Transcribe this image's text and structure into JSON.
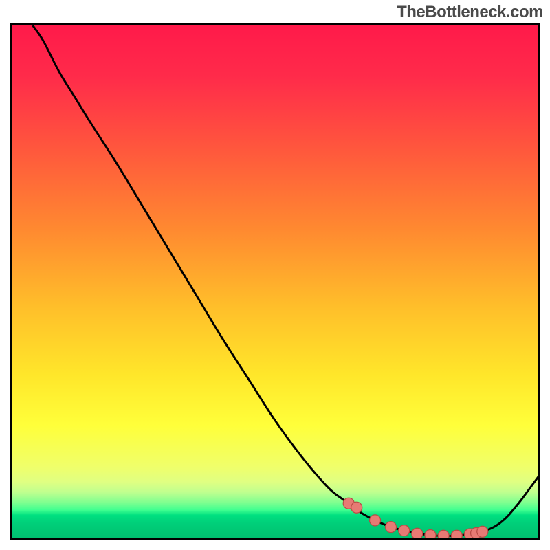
{
  "attribution": "TheBottleneck.com",
  "colors": {
    "gradient_stops": [
      {
        "offset": 0.0,
        "color": "#ff1a4a"
      },
      {
        "offset": 0.1,
        "color": "#ff2b4a"
      },
      {
        "offset": 0.25,
        "color": "#ff5a3c"
      },
      {
        "offset": 0.4,
        "color": "#ff8a30"
      },
      {
        "offset": 0.55,
        "color": "#ffbf2a"
      },
      {
        "offset": 0.68,
        "color": "#ffe62a"
      },
      {
        "offset": 0.78,
        "color": "#ffff3a"
      },
      {
        "offset": 0.82,
        "color": "#f7ff52"
      },
      {
        "offset": 0.86,
        "color": "#f0ff6a"
      },
      {
        "offset": 0.89,
        "color": "#e0ff82"
      },
      {
        "offset": 0.91,
        "color": "#c0ff8f"
      },
      {
        "offset": 0.93,
        "color": "#80ff90"
      },
      {
        "offset": 0.945,
        "color": "#40ff90"
      },
      {
        "offset": 0.955,
        "color": "#00e080"
      },
      {
        "offset": 0.97,
        "color": "#00d07a"
      },
      {
        "offset": 0.985,
        "color": "#00c874"
      },
      {
        "offset": 1.0,
        "color": "#00c070"
      }
    ],
    "curve": "#000000",
    "marker_fill": "#e77a74",
    "marker_stroke": "#b84a44"
  },
  "chart_data": {
    "type": "line",
    "title": "",
    "xlabel": "",
    "ylabel": "",
    "xlim": [
      0,
      100
    ],
    "ylim": [
      0,
      100
    ],
    "grid": false,
    "series": [
      {
        "name": "bottleneck-curve",
        "x": [
          4,
          6,
          9,
          12,
          15,
          20,
          25,
          30,
          35,
          40,
          45,
          50,
          55,
          60,
          63,
          66,
          69,
          72,
          75,
          78,
          81,
          84,
          87,
          90,
          93,
          96,
          100
        ],
        "y": [
          100,
          97,
          91,
          86,
          81,
          73,
          64.5,
          56,
          47.5,
          39,
          31,
          23,
          16,
          10,
          7.5,
          5.2,
          3.5,
          2.2,
          1.4,
          0.8,
          0.5,
          0.5,
          0.8,
          1.5,
          3.2,
          6.5,
          12
        ]
      }
    ],
    "markers": {
      "name": "highlight-points",
      "x": [
        64,
        65.5,
        69,
        72,
        74.5,
        77,
        79.5,
        82,
        84.5,
        87,
        88.2,
        89.4
      ],
      "y": [
        6.8,
        6.0,
        3.5,
        2.2,
        1.5,
        0.9,
        0.6,
        0.5,
        0.5,
        0.8,
        1.0,
        1.3
      ]
    }
  }
}
